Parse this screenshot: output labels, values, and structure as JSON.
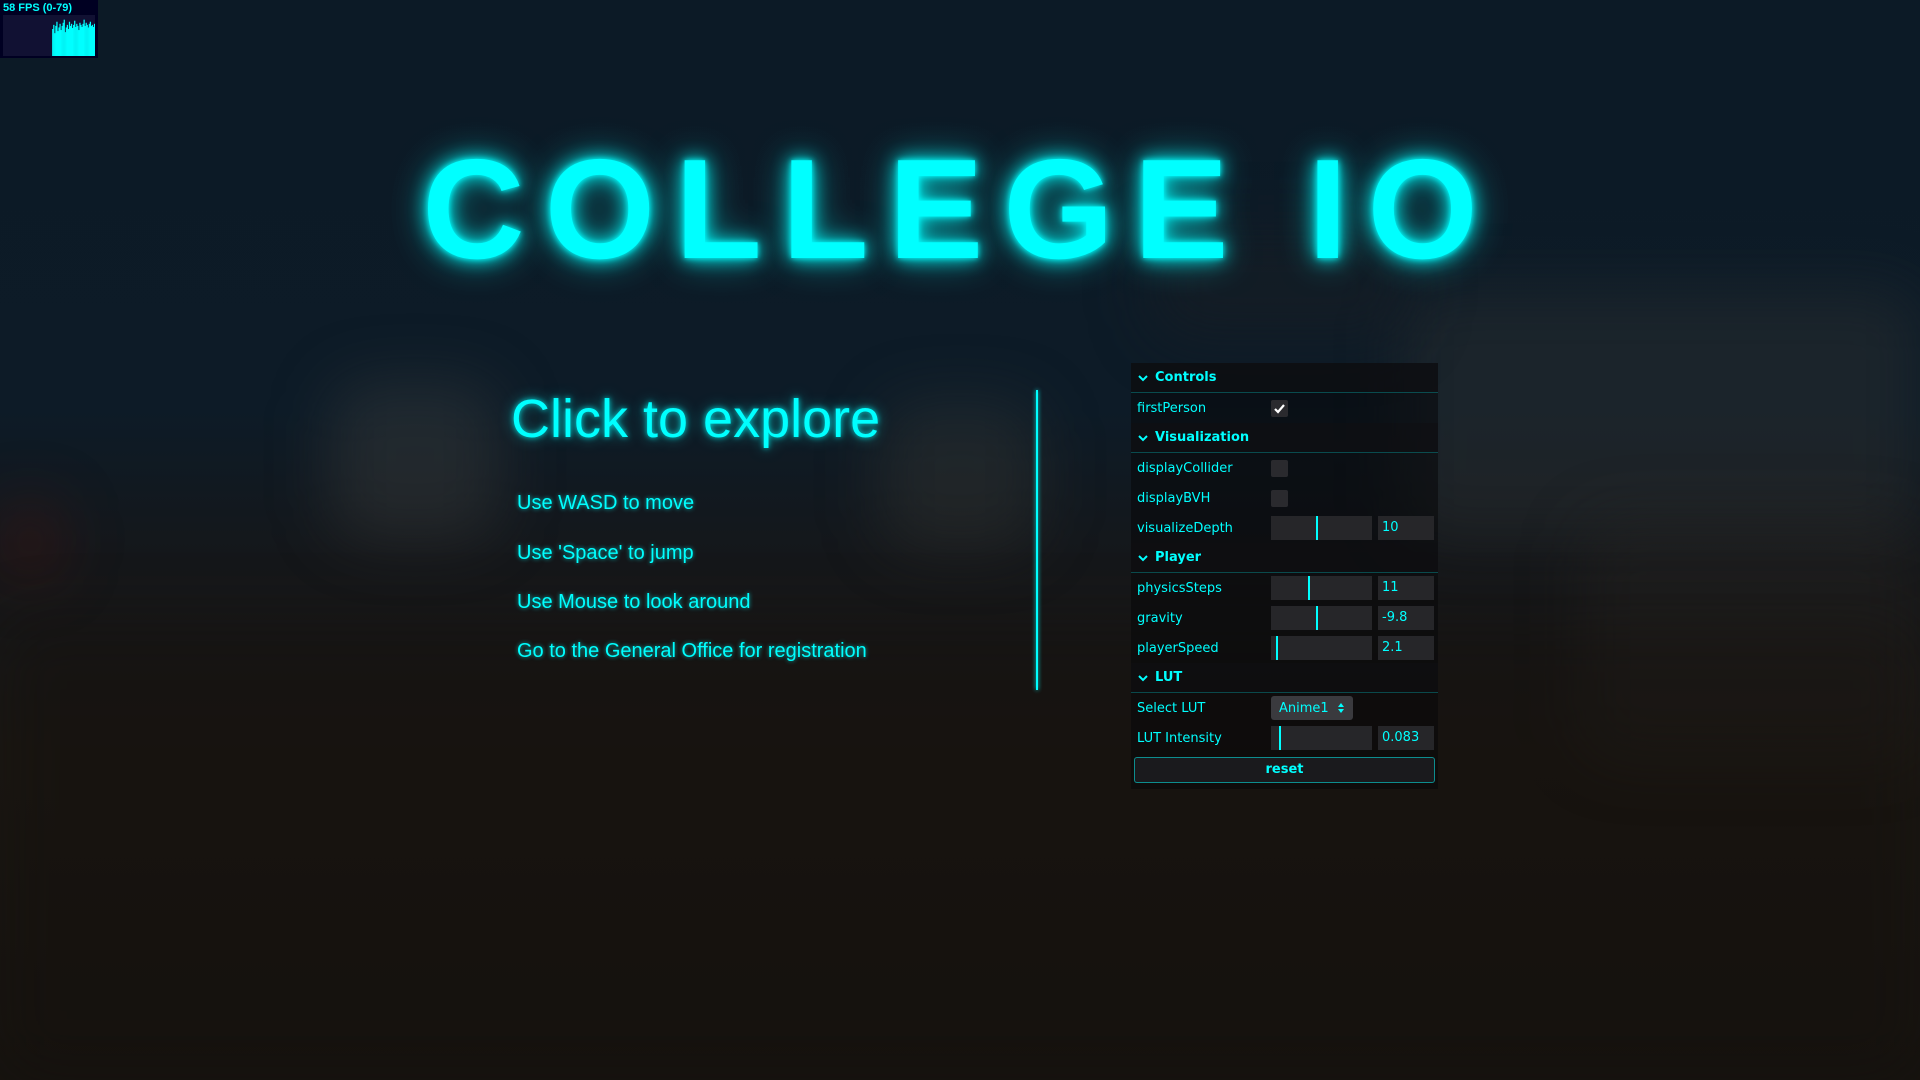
{
  "fps": {
    "label": "58 FPS (0-79)",
    "samples": [
      0,
      0,
      0,
      0,
      0,
      0,
      0,
      0,
      0,
      0,
      0,
      0,
      0,
      0,
      0,
      0,
      0,
      0,
      0,
      0,
      0,
      0,
      0,
      0,
      0,
      0,
      0,
      0,
      0,
      0,
      0,
      0,
      0,
      0,
      0,
      0,
      0,
      0,
      0,
      0,
      0,
      0,
      0,
      0,
      0,
      0,
      0,
      52,
      60,
      44,
      58,
      66,
      48,
      55,
      62,
      50,
      58,
      64,
      70,
      46,
      55,
      60,
      52,
      66,
      58,
      62,
      54,
      60,
      68,
      56,
      62,
      58,
      50,
      64,
      60,
      56,
      62,
      70,
      58,
      64,
      60,
      55,
      62,
      66,
      58,
      60,
      56,
      62
    ]
  },
  "title": "COLLEGE IO",
  "intro": {
    "heading": "Click to explore",
    "lines": [
      "Use WASD to move",
      "Use 'Space' to jump",
      "Use Mouse to look around",
      "Go to the General Office for registration"
    ]
  },
  "gui": {
    "controls": {
      "title": "Controls",
      "firstPerson": {
        "label": "firstPerson",
        "checked": true
      }
    },
    "visualization": {
      "title": "Visualization",
      "displayCollider": {
        "label": "displayCollider",
        "checked": false
      },
      "displayBVH": {
        "label": "displayBVH",
        "checked": false
      },
      "visualizeDepth": {
        "label": "visualizeDepth",
        "value": "10",
        "fraction": 0.45
      }
    },
    "player": {
      "title": "Player",
      "physicsSteps": {
        "label": "physicsSteps",
        "value": "11",
        "fraction": 0.37
      },
      "gravity": {
        "label": "gravity",
        "value": "-9.8",
        "fraction": 0.45
      },
      "playerSpeed": {
        "label": "playerSpeed",
        "value": "2.1",
        "fraction": 0.05
      }
    },
    "lut": {
      "title": "LUT",
      "select": {
        "label": "Select LUT",
        "value": "Anime1"
      },
      "intensity": {
        "label": "LUT Intensity",
        "value": "0.083",
        "fraction": 0.08
      }
    },
    "reset_label": "reset"
  },
  "colors": {
    "accent": "#00ffff"
  },
  "icons": {
    "chevron": "chevron-down-icon",
    "check": "check-icon",
    "updown": "select-arrows-icon"
  }
}
